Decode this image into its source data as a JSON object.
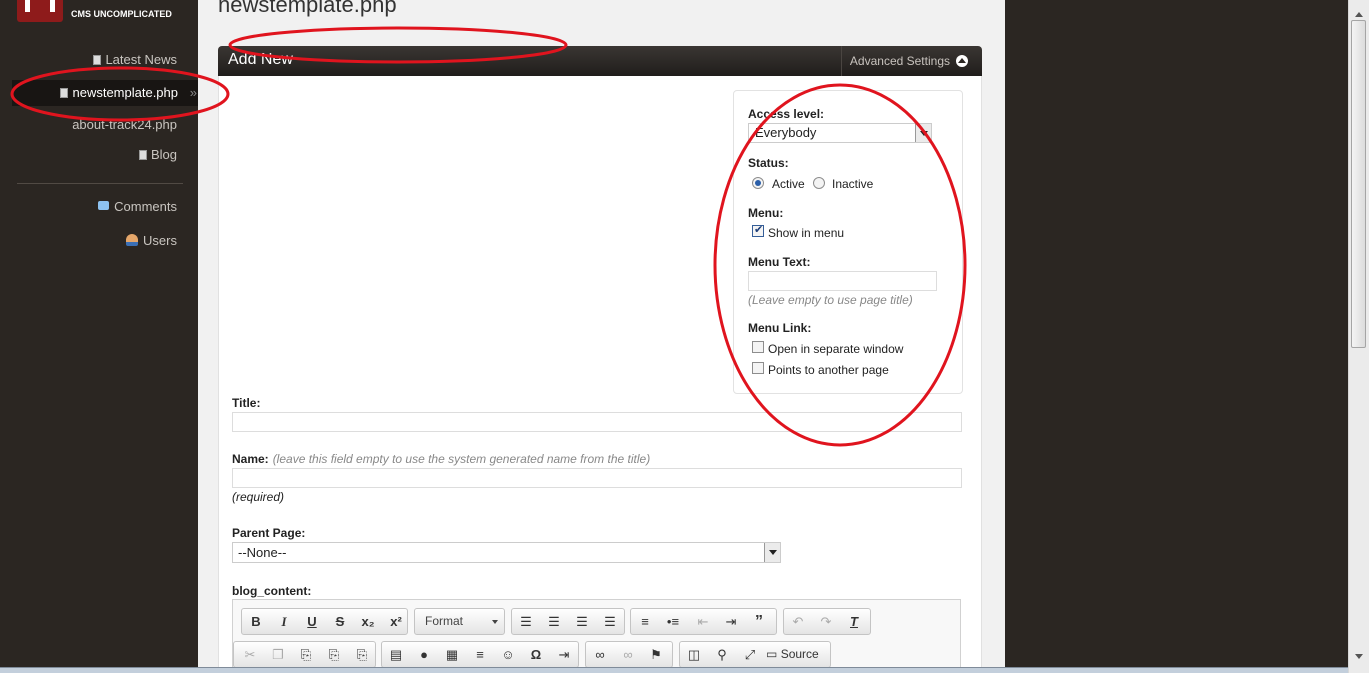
{
  "logo": {
    "tagline": "CMS UNCOMPLICATED"
  },
  "sidebar": {
    "items": [
      {
        "label": "Latest News"
      },
      {
        "label": "newstemplate.php"
      },
      {
        "label": "about-track24.php"
      },
      {
        "label": "Blog"
      },
      {
        "label": "Comments"
      },
      {
        "label": "Users"
      }
    ],
    "current_chevron": "»"
  },
  "page": {
    "title": "newstemplate.php"
  },
  "form_header": {
    "title": "Add New",
    "advanced_settings": "Advanced Settings"
  },
  "advanced": {
    "access_label": "Access level:",
    "access_value": "Everybody",
    "status_label": "Status:",
    "status_active": "Active",
    "status_inactive": "Inactive",
    "menu_label": "Menu:",
    "show_in_menu": "Show in menu",
    "menu_text_label": "Menu Text:",
    "menu_text_hint": "(Leave empty to use page title)",
    "menu_link_label": "Menu Link:",
    "open_separate": "Open in separate window",
    "points_to_page": "Points to another page"
  },
  "fields": {
    "title_label": "Title:",
    "name_label": "Name:",
    "name_hint": "(leave this field empty to use the system generated name from the title)",
    "required_note": "(required)",
    "parent_label": "Parent Page:",
    "parent_value": "--None--",
    "content_label": "blog_content:"
  },
  "editor": {
    "format_label": "Format",
    "source_label": "Source",
    "icons": [
      "bold-icon",
      "italic-icon",
      "underline-icon",
      "strikethrough-icon",
      "subscript-icon",
      "superscript-icon",
      "align-left-icon",
      "align-center-icon",
      "align-right-icon",
      "justify-icon",
      "numbered-list-icon",
      "bulleted-list-icon",
      "outdent-icon",
      "indent-icon",
      "blockquote-icon",
      "undo-icon",
      "redo-icon",
      "remove-format-icon",
      "cut-icon",
      "copy-icon",
      "paste-icon",
      "paste-text-icon",
      "paste-word-icon",
      "image-icon",
      "flash-icon",
      "table-icon",
      "horizontal-rule-icon",
      "smiley-icon",
      "special-char-icon",
      "page-break-icon",
      "link-icon",
      "unlink-icon",
      "anchor-icon",
      "templates-icon",
      "preview-icon",
      "maximize-icon",
      "source-icon"
    ]
  },
  "colors": {
    "annotation": "#e0141e",
    "sidebar_bg": "#2b2622",
    "header_bg": "#2a2623"
  }
}
